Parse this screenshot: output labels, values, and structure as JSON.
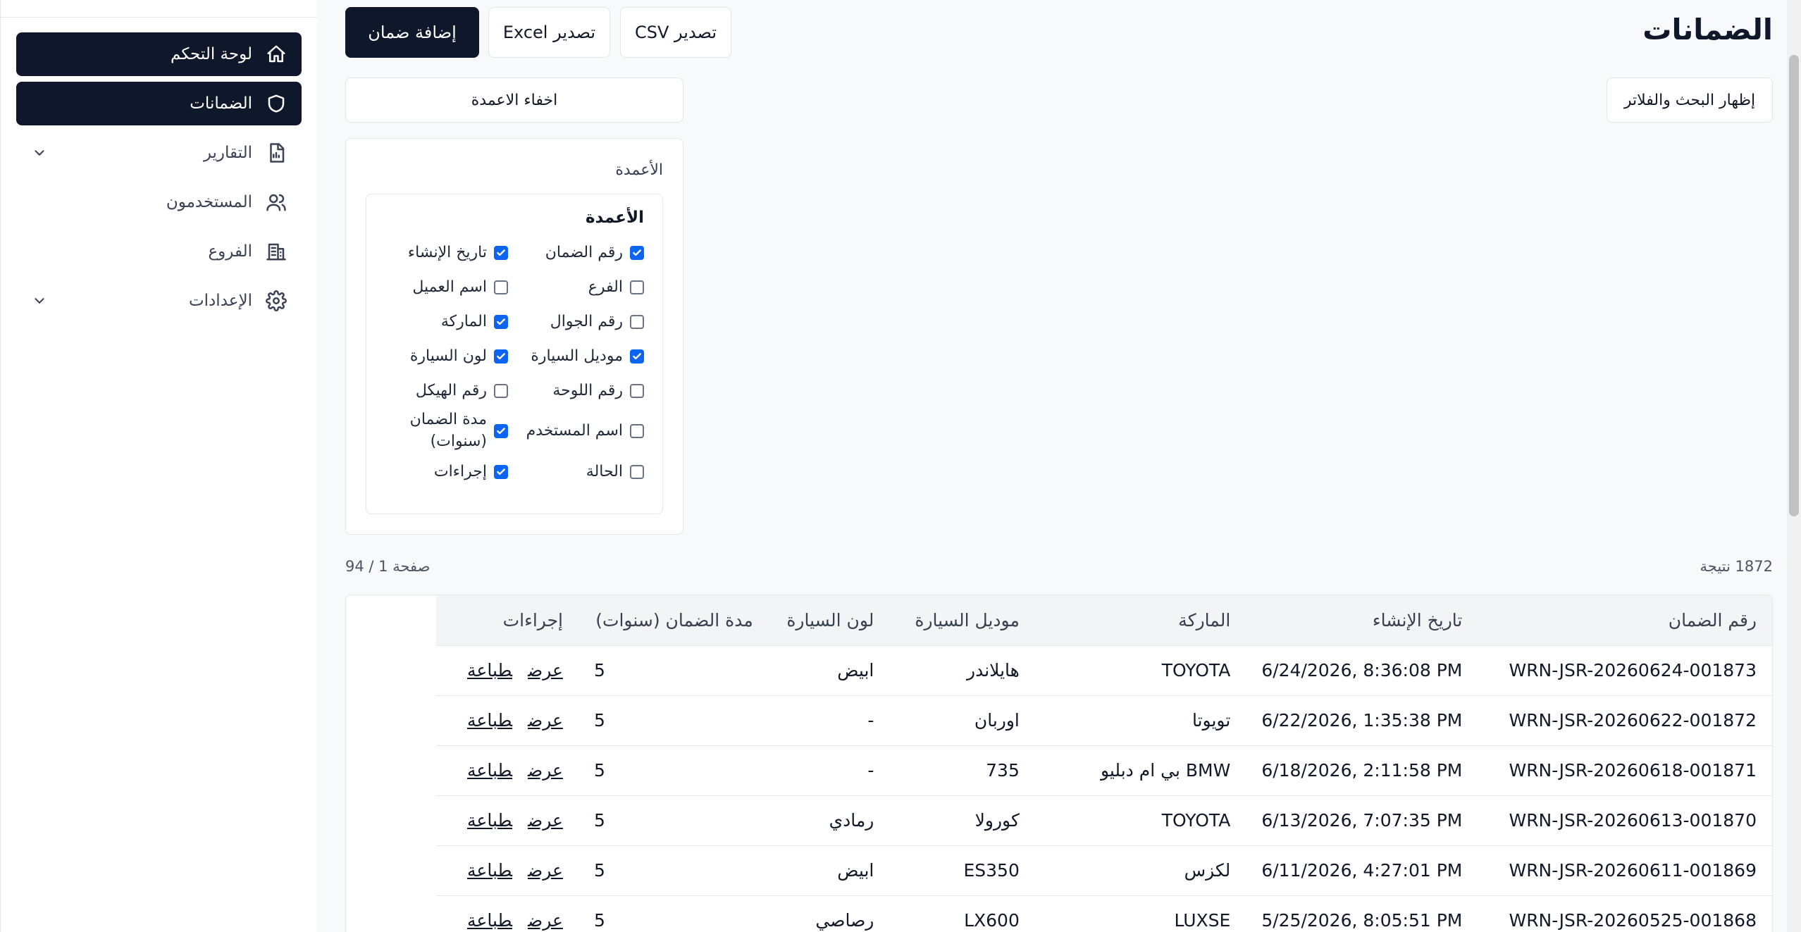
{
  "sidebar": {
    "items": [
      {
        "label": "لوحة التحكم",
        "icon": "home-icon",
        "active": true
      },
      {
        "label": "الضمانات",
        "icon": "shield-icon",
        "active": true
      },
      {
        "label": "التقارير",
        "icon": "report-icon",
        "expandable": true
      },
      {
        "label": "المستخدمون",
        "icon": "users-icon"
      },
      {
        "label": "الفروع",
        "icon": "building-icon"
      },
      {
        "label": "الإعدادات",
        "icon": "gear-icon",
        "expandable": true
      }
    ]
  },
  "header": {
    "title": "الضمانات",
    "add_label": "إضافة ضمان",
    "excel_label": "تصدير Excel",
    "csv_label": "تصدير CSV",
    "hide_cols_label": "اخفاء الاعمدة",
    "filters_label": "إظهار البحث والفلاتر"
  },
  "columns_panel": {
    "title": "الأعمدة",
    "inner_title": "الأعمدة",
    "options": [
      {
        "label": "رقم الضمان",
        "checked": true
      },
      {
        "label": "تاريخ الإنشاء",
        "checked": true
      },
      {
        "label": "الفرع",
        "checked": false
      },
      {
        "label": "اسم العميل",
        "checked": false
      },
      {
        "label": "رقم الجوال",
        "checked": false
      },
      {
        "label": "الماركة",
        "checked": true
      },
      {
        "label": "موديل السيارة",
        "checked": true
      },
      {
        "label": "لون السيارة",
        "checked": true
      },
      {
        "label": "رقم اللوحة",
        "checked": false
      },
      {
        "label": "رقم الهيكل",
        "checked": false
      },
      {
        "label": "اسم المستخدم",
        "checked": false
      },
      {
        "label": "مدة الضمان (سنوات)",
        "checked": true
      },
      {
        "label": "الحالة",
        "checked": false
      },
      {
        "label": "إجراءات",
        "checked": true
      }
    ]
  },
  "results": {
    "count_text": "1872 نتيجة",
    "page_text": "صفحة 1 / 94"
  },
  "table": {
    "headers": [
      "رقم الضمان",
      "تاريخ الإنشاء",
      "الماركة",
      "موديل السيارة",
      "لون السيارة",
      "مدة الضمان (سنوات)",
      "إجراءات"
    ],
    "view_label": "عرض",
    "print_label": "طباعة",
    "rows": [
      {
        "no": "WRN-JSR-20260624-001873",
        "date": "6/24/2026, 8:36:08 PM",
        "brand": "TOYOTA",
        "model": "هايلاندر",
        "color": "ابيض",
        "years": "5"
      },
      {
        "no": "WRN-JSR-20260622-001872",
        "date": "6/22/2026, 1:35:38 PM",
        "brand": "تويوتا",
        "model": "اوربان",
        "color": "-",
        "years": "5"
      },
      {
        "no": "WRN-JSR-20260618-001871",
        "date": "6/18/2026, 2:11:58 PM",
        "brand": "BMW بي ام دبليو",
        "model": "735",
        "color": "-",
        "years": "5"
      },
      {
        "no": "WRN-JSR-20260613-001870",
        "date": "6/13/2026, 7:07:35 PM",
        "brand": "TOYOTA",
        "model": "كورولا",
        "color": "رمادي",
        "years": "5"
      },
      {
        "no": "WRN-JSR-20260611-001869",
        "date": "6/11/2026, 4:27:01 PM",
        "brand": "لكزس",
        "model": "ES350",
        "color": "ابيض",
        "years": "5"
      },
      {
        "no": "WRN-JSR-20260525-001868",
        "date": "5/25/2026, 8:05:51 PM",
        "brand": "LUXSE",
        "model": "LX600",
        "color": "رصاصي",
        "years": "5"
      }
    ]
  }
}
